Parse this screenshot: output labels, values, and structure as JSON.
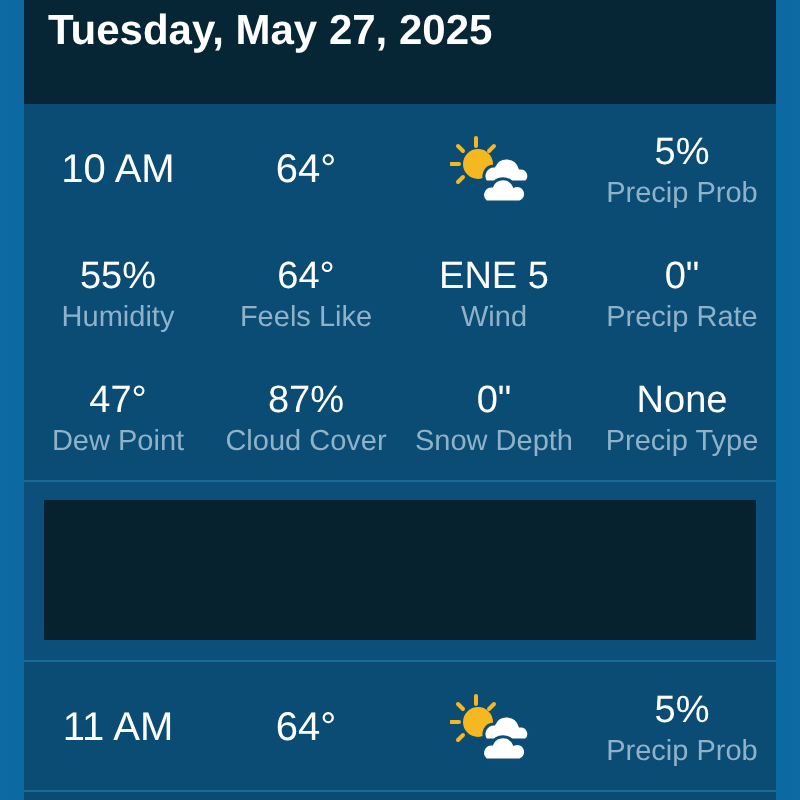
{
  "date": "Tuesday, May 27, 2025",
  "hours": [
    {
      "time": "10 AM",
      "temp": "64°",
      "stats": [
        {
          "value": "5%",
          "label": "Precip Prob"
        },
        {
          "value": "55%",
          "label": "Humidity"
        },
        {
          "value": "64°",
          "label": "Feels Like"
        },
        {
          "value": "ENE 5",
          "label": "Wind"
        },
        {
          "value": "0\"",
          "label": "Precip Rate"
        },
        {
          "value": "47°",
          "label": "Dew Point"
        },
        {
          "value": "87%",
          "label": "Cloud Cover"
        },
        {
          "value": "0\"",
          "label": "Snow Depth"
        },
        {
          "value": "None",
          "label": "Precip Type"
        }
      ]
    },
    {
      "time": "11 AM",
      "temp": "64°",
      "stats": [
        {
          "value": "5%",
          "label": "Precip Prob"
        }
      ]
    }
  ]
}
